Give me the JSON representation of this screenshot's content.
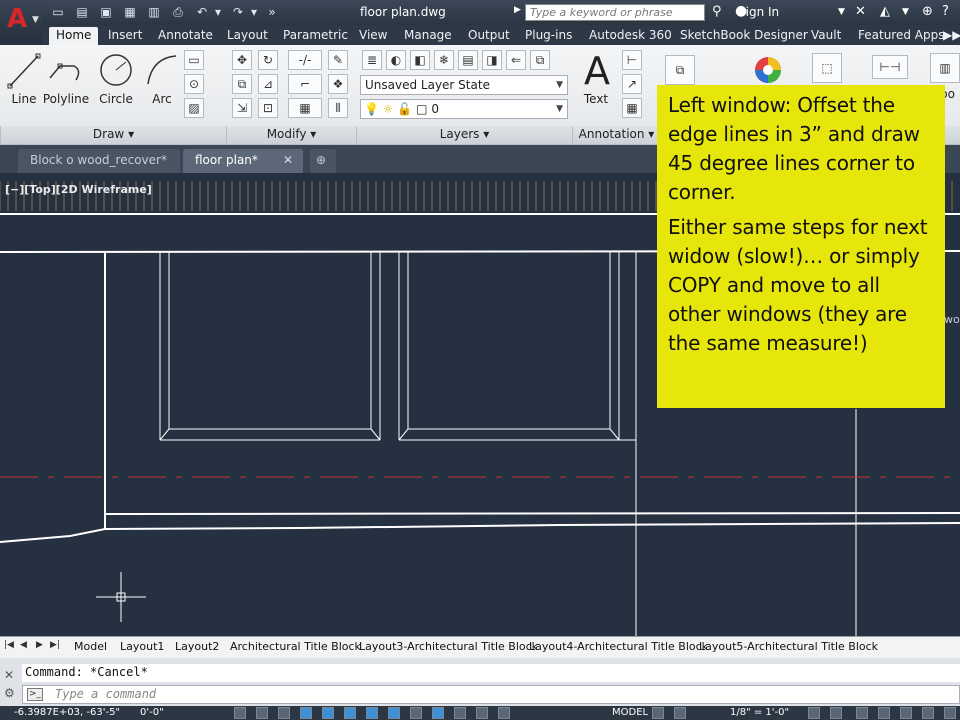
{
  "titlebar": {
    "document_title": "floor plan.dwg",
    "search_placeholder": "Type a keyword or phrase",
    "signin_label": "Sign In"
  },
  "ribbon_tabs": [
    "Home",
    "Insert",
    "Annotate",
    "Layout",
    "Parametric",
    "View",
    "Manage",
    "Output",
    "Plug-ins",
    "Autodesk 360",
    "SketchBook Designer",
    "Vault",
    "Featured Apps"
  ],
  "draw_tools": [
    "Line",
    "Polyline",
    "Circle",
    "Arc"
  ],
  "layers": {
    "layer_state": "Unsaved Layer State",
    "current_layer": "0"
  },
  "annotation": {
    "text_tool": "Text"
  },
  "panels": {
    "draw": "Draw",
    "modify": "Modify",
    "layers": "Layers",
    "annotation": "Annotation"
  },
  "partial_label": "bo",
  "doc_tabs": [
    "Block o wood_recover*",
    "floor plan*"
  ],
  "viewport": {
    "label": "[−][Top][2D Wireframe]",
    "partial_right_label": "wo"
  },
  "callout": {
    "paragraph1": "Left window: Offset the edge lines in 3” and draw 45 degree lines corner to corner.",
    "paragraph2": "Either same steps for next widow (slow!)… or simply COPY and move to all other windows (they are the same measure!)"
  },
  "layout_tabs": [
    "Model",
    "Layout1",
    "Layout2",
    "Architectural Title Block",
    "Layout3-Architectural Title Block",
    "Layout4-Architectural Title Block",
    "Layout5-Architectural Title Block"
  ],
  "command": {
    "history": "Command: *Cancel*",
    "placeholder": "Type a command"
  },
  "statusbar": {
    "coordinates": "-6.3987E+03, -63'-5\"",
    "z": "0'-0\"",
    "model": "MODEL",
    "scale": "1/8\" = 1'-0\""
  },
  "colors": {
    "drawing_bg": "#253140",
    "callout_bg": "#e6e60a",
    "centerline": "#c83232",
    "logo_red": "#d8262b"
  }
}
